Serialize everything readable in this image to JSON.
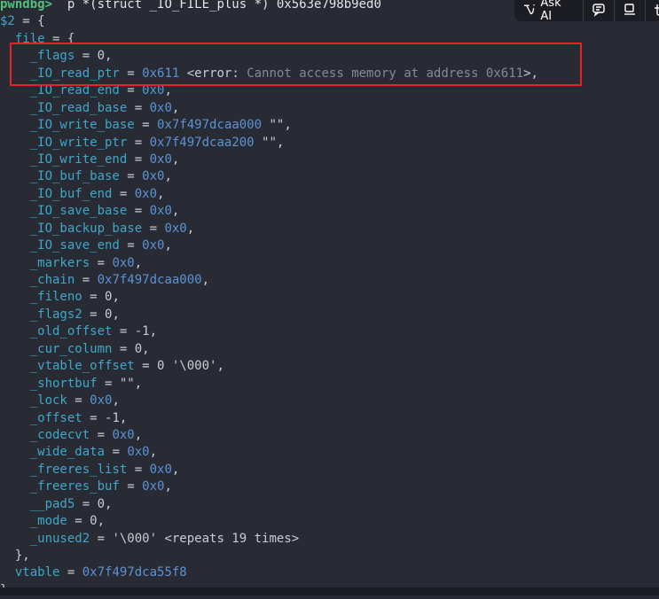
{
  "toolbar": {
    "ask_ai_label": "Ask AI",
    "icons": [
      "ai-sparkle-icon",
      "comment-icon",
      "panel-icon",
      "text-icon"
    ]
  },
  "colors": {
    "background": "#282b33",
    "field": "#3fa7c9",
    "value": "#5c93d6",
    "error": "#858a93",
    "prompt": "#4ec27a",
    "highlight": "#e8222a"
  },
  "terminal": {
    "lines": [
      [
        [
          "prompt",
          "pwndbg> "
        ],
        [
          "w",
          " p *(struct _IO_FILE_plus *) 0x563e798b9ed0"
        ]
      ],
      [
        [
          "n",
          "$2"
        ],
        [
          "p",
          " = {"
        ]
      ],
      [
        [
          "p",
          "  "
        ],
        [
          "n",
          "file"
        ],
        [
          "p",
          " = {"
        ]
      ],
      [
        [
          "p",
          "    "
        ],
        [
          "n",
          "_flags"
        ],
        [
          "p",
          " = 0,"
        ]
      ],
      [
        [
          "p",
          "    "
        ],
        [
          "n",
          "_IO_read_ptr"
        ],
        [
          "p",
          " = "
        ],
        [
          "v",
          "0x611"
        ],
        [
          "p",
          " <error: "
        ],
        [
          "e",
          "Cannot access memory at address 0x611"
        ],
        [
          "p",
          ">,"
        ]
      ],
      [
        [
          "p",
          "    "
        ],
        [
          "n",
          "_IO_read_end"
        ],
        [
          "p",
          " = "
        ],
        [
          "v",
          "0x0"
        ],
        [
          "p",
          ","
        ]
      ],
      [
        [
          "p",
          "    "
        ],
        [
          "n",
          "_IO_read_base"
        ],
        [
          "p",
          " = "
        ],
        [
          "v",
          "0x0"
        ],
        [
          "p",
          ","
        ]
      ],
      [
        [
          "p",
          "    "
        ],
        [
          "n",
          "_IO_write_base"
        ],
        [
          "p",
          " = "
        ],
        [
          "v",
          "0x7f497dcaa000"
        ],
        [
          "p",
          " \"\","
        ]
      ],
      [
        [
          "p",
          "    "
        ],
        [
          "n",
          "_IO_write_ptr"
        ],
        [
          "p",
          " = "
        ],
        [
          "v",
          "0x7f497dcaa200"
        ],
        [
          "p",
          " \"\","
        ]
      ],
      [
        [
          "p",
          "    "
        ],
        [
          "n",
          "_IO_write_end"
        ],
        [
          "p",
          " = "
        ],
        [
          "v",
          "0x0"
        ],
        [
          "p",
          ","
        ]
      ],
      [
        [
          "p",
          "    "
        ],
        [
          "n",
          "_IO_buf_base"
        ],
        [
          "p",
          " = "
        ],
        [
          "v",
          "0x0"
        ],
        [
          "p",
          ","
        ]
      ],
      [
        [
          "p",
          "    "
        ],
        [
          "n",
          "_IO_buf_end"
        ],
        [
          "p",
          " = "
        ],
        [
          "v",
          "0x0"
        ],
        [
          "p",
          ","
        ]
      ],
      [
        [
          "p",
          "    "
        ],
        [
          "n",
          "_IO_save_base"
        ],
        [
          "p",
          " = "
        ],
        [
          "v",
          "0x0"
        ],
        [
          "p",
          ","
        ]
      ],
      [
        [
          "p",
          "    "
        ],
        [
          "n",
          "_IO_backup_base"
        ],
        [
          "p",
          " = "
        ],
        [
          "v",
          "0x0"
        ],
        [
          "p",
          ","
        ]
      ],
      [
        [
          "p",
          "    "
        ],
        [
          "n",
          "_IO_save_end"
        ],
        [
          "p",
          " = "
        ],
        [
          "v",
          "0x0"
        ],
        [
          "p",
          ","
        ]
      ],
      [
        [
          "p",
          "    "
        ],
        [
          "n",
          "_markers"
        ],
        [
          "p",
          " = "
        ],
        [
          "v",
          "0x0"
        ],
        [
          "p",
          ","
        ]
      ],
      [
        [
          "p",
          "    "
        ],
        [
          "n",
          "_chain"
        ],
        [
          "p",
          " = "
        ],
        [
          "v",
          "0x7f497dcaa000"
        ],
        [
          "p",
          ","
        ]
      ],
      [
        [
          "p",
          "    "
        ],
        [
          "n",
          "_fileno"
        ],
        [
          "p",
          " = 0,"
        ]
      ],
      [
        [
          "p",
          "    "
        ],
        [
          "n",
          "_flags2"
        ],
        [
          "p",
          " = 0,"
        ]
      ],
      [
        [
          "p",
          "    "
        ],
        [
          "n",
          "_old_offset"
        ],
        [
          "p",
          " = -1,"
        ]
      ],
      [
        [
          "p",
          "    "
        ],
        [
          "n",
          "_cur_column"
        ],
        [
          "p",
          " = 0,"
        ]
      ],
      [
        [
          "p",
          "    "
        ],
        [
          "n",
          "_vtable_offset"
        ],
        [
          "p",
          " = 0 '\\000',"
        ]
      ],
      [
        [
          "p",
          "    "
        ],
        [
          "n",
          "_shortbuf"
        ],
        [
          "p",
          " = \"\","
        ]
      ],
      [
        [
          "p",
          "    "
        ],
        [
          "n",
          "_lock"
        ],
        [
          "p",
          " = "
        ],
        [
          "v",
          "0x0"
        ],
        [
          "p",
          ","
        ]
      ],
      [
        [
          "p",
          "    "
        ],
        [
          "n",
          "_offset"
        ],
        [
          "p",
          " = -1,"
        ]
      ],
      [
        [
          "p",
          "    "
        ],
        [
          "n",
          "_codecvt"
        ],
        [
          "p",
          " = "
        ],
        [
          "v",
          "0x0"
        ],
        [
          "p",
          ","
        ]
      ],
      [
        [
          "p",
          "    "
        ],
        [
          "n",
          "_wide_data"
        ],
        [
          "p",
          " = "
        ],
        [
          "v",
          "0x0"
        ],
        [
          "p",
          ","
        ]
      ],
      [
        [
          "p",
          "    "
        ],
        [
          "n",
          "_freeres_list"
        ],
        [
          "p",
          " = "
        ],
        [
          "v",
          "0x0"
        ],
        [
          "p",
          ","
        ]
      ],
      [
        [
          "p",
          "    "
        ],
        [
          "n",
          "_freeres_buf"
        ],
        [
          "p",
          " = "
        ],
        [
          "v",
          "0x0"
        ],
        [
          "p",
          ","
        ]
      ],
      [
        [
          "p",
          "    "
        ],
        [
          "n",
          "__pad5"
        ],
        [
          "p",
          " = 0,"
        ]
      ],
      [
        [
          "p",
          "    "
        ],
        [
          "n",
          "_mode"
        ],
        [
          "p",
          " = 0,"
        ]
      ],
      [
        [
          "p",
          "    "
        ],
        [
          "n",
          "_unused2"
        ],
        [
          "p",
          " = '\\000' <repeats 19 times>"
        ]
      ],
      [
        [
          "p",
          "  },"
        ]
      ],
      [
        [
          "p",
          "  "
        ],
        [
          "n",
          "vtable"
        ],
        [
          "p",
          " = "
        ],
        [
          "v",
          "0x7f497dca55f8"
        ]
      ],
      [
        [
          "p",
          "}"
        ]
      ]
    ]
  }
}
